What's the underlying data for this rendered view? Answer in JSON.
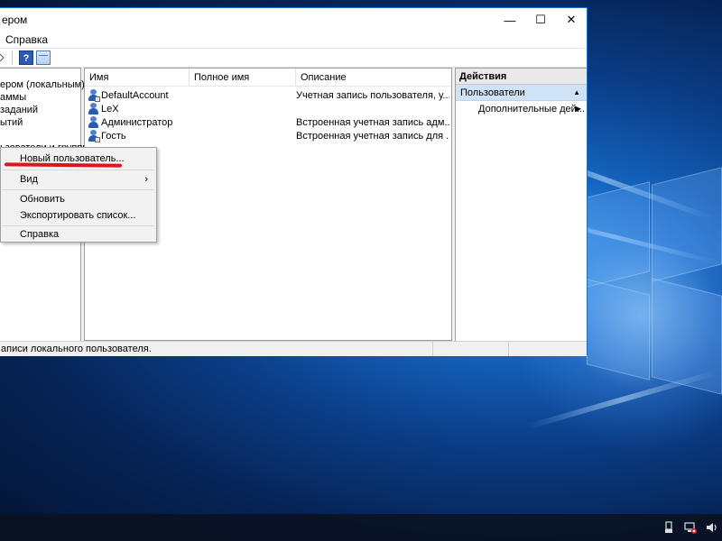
{
  "window": {
    "title": "ером",
    "controls": {
      "minimize": "—",
      "maximize": "☐",
      "close": "✕"
    }
  },
  "menubar": {
    "items": [
      "Справка"
    ]
  },
  "tree": {
    "items": [
      "ером (локальным)",
      "аммы",
      "заданий",
      "ытий",
      "ьзователи и группы"
    ]
  },
  "list": {
    "columns": [
      "Имя",
      "Полное имя",
      "Описание"
    ],
    "rows": [
      {
        "name": "DefaultAccount",
        "fullname": "",
        "description": "Учетная запись пользователя, у..."
      },
      {
        "name": "LeX",
        "fullname": "",
        "description": ""
      },
      {
        "name": "Администратор",
        "fullname": "",
        "description": "Встроенная учетная запись адм..."
      },
      {
        "name": "Гость",
        "fullname": "",
        "description": "Встроенная учетная запись для ..."
      }
    ]
  },
  "actions": {
    "title": "Действия",
    "section": "Пользователи",
    "items": [
      "Дополнительные дей..."
    ]
  },
  "context_menu": {
    "items": [
      "Новый пользователь...",
      "Вид",
      "Обновить",
      "Экспортировать список...",
      "Справка"
    ],
    "submenu_arrow": "›"
  },
  "statusbar": {
    "text": "аписи локального пользователя."
  },
  "colors": {
    "accent": "#1e6fc2",
    "selection": "#cfe2f6",
    "highlight_mark": "#e0141e",
    "taskbar": "#0a1222"
  }
}
